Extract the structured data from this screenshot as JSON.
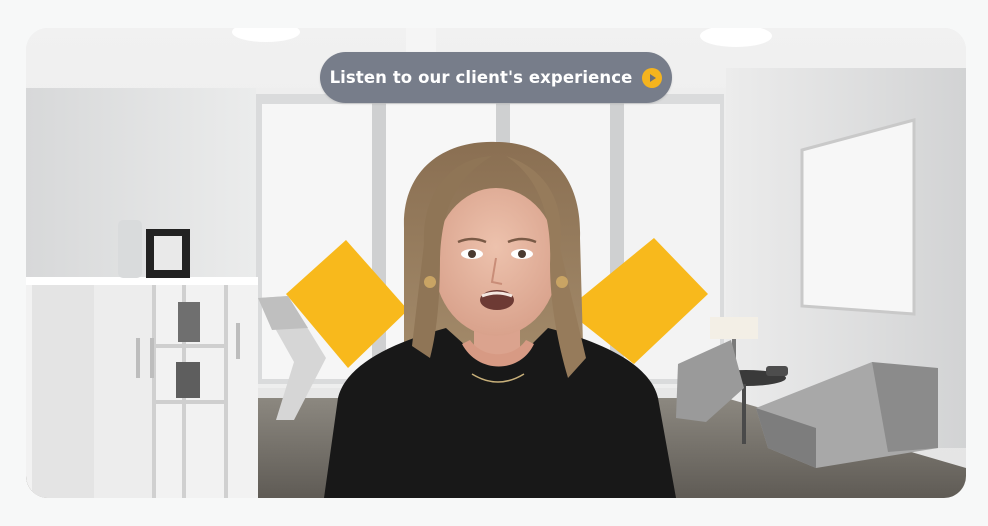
{
  "video_card": {
    "cta": {
      "label": "Listen to our client's experience",
      "icon": "play-circle-icon",
      "icon_color": "#f5b41e"
    },
    "colors": {
      "pill_background": "#777d8a",
      "accent_yellow": "#f8b91c"
    }
  }
}
